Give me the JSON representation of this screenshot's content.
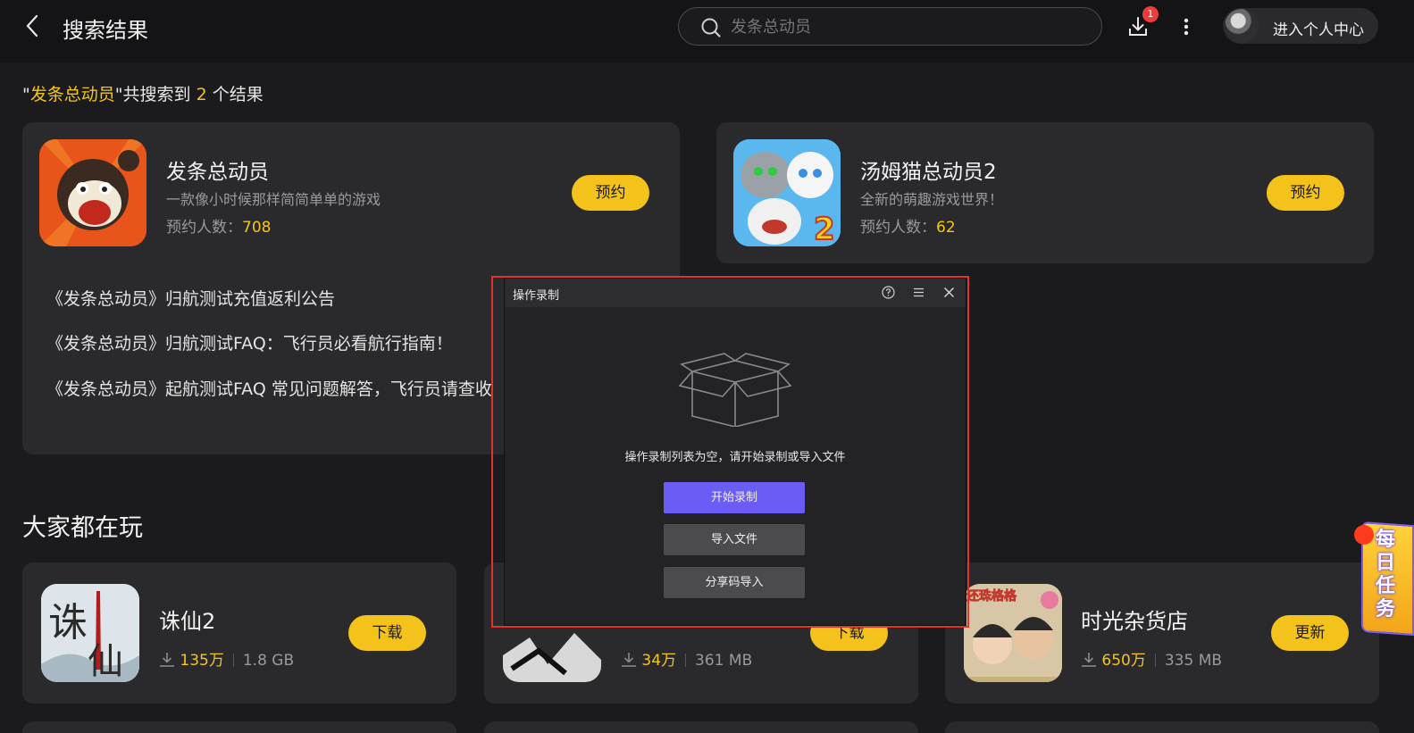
{
  "header": {
    "title": "搜索结果",
    "search_placeholder": "发条总动员",
    "download_badge": "1",
    "user_label": "进入个人中心"
  },
  "summary": {
    "quote_open": "\"",
    "keyword": "发条总动员",
    "mid": "\"共搜索到",
    "count": "2",
    "tail": "个结果"
  },
  "results": [
    {
      "name": "发条总动员",
      "desc": "一款像小时候那样简简单单的游戏",
      "count_label": "预约人数：",
      "count": "708",
      "button": "预约"
    },
    {
      "name": "汤姆猫总动员2",
      "desc": "全新的萌趣游戏世界！",
      "count_label": "预约人数：",
      "count": "62",
      "button": "预约"
    }
  ],
  "news": [
    "《发条总动员》归航测试充值返利公告",
    "《发条总动员》归航测试FAQ：飞行员必看航行指南！",
    "《发条总动员》起航测试FAQ 常见问题解答，飞行员请查收"
  ],
  "section_title": "大家都在玩",
  "games": [
    {
      "name": "诛仙2",
      "downloads": "135万",
      "size": "1.8 GB",
      "button": "下载",
      "icon_text": "诛仙"
    },
    {
      "name": "",
      "downloads": "34万",
      "size": "361 MB",
      "button": "下载"
    },
    {
      "name": "时光杂货店",
      "downloads": "650万",
      "size": "335 MB",
      "button": "更新",
      "icon_text": "还珠格格"
    }
  ],
  "daily_task": "每日任务",
  "dialog": {
    "title": "操作录制",
    "empty_text": "操作录制列表为空，请开始录制或导入文件",
    "start_button": "开始录制",
    "import_button": "导入文件",
    "share_button": "分享码导入"
  },
  "colors": {
    "accent": "#f3c21b",
    "primary_button": "#6b5cf6",
    "highlight": "#e0342b"
  }
}
